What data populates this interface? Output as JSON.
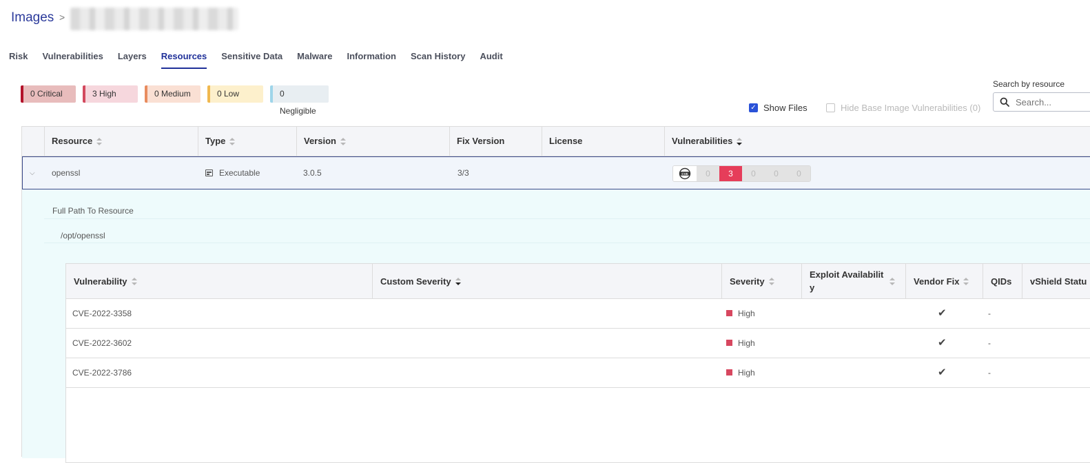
{
  "breadcrumb": {
    "root": "Images",
    "separator": ">"
  },
  "tabs": [
    {
      "label": "Risk",
      "active": false
    },
    {
      "label": "Vulnerabilities",
      "active": false
    },
    {
      "label": "Layers",
      "active": false
    },
    {
      "label": "Resources",
      "active": true
    },
    {
      "label": "Sensitive Data",
      "active": false
    },
    {
      "label": "Malware",
      "active": false
    },
    {
      "label": "Information",
      "active": false
    },
    {
      "label": "Scan History",
      "active": false
    },
    {
      "label": "Audit",
      "active": false
    }
  ],
  "severity_chips": {
    "critical": "0 Critical",
    "high": "3 High",
    "medium": "0 Medium",
    "low": "0 Low",
    "negligible": "0 Negligible"
  },
  "options": {
    "show_files_label": "Show Files",
    "show_files_checked": true,
    "hide_base_label": "Hide Base Image Vulnerabilities (0)",
    "hide_base_checked": false
  },
  "search": {
    "label": "Search by resource",
    "placeholder": "Search..."
  },
  "table": {
    "columns": [
      "Resource",
      "Type",
      "Version",
      "Fix Version",
      "License",
      "Vulnerabilities"
    ],
    "row": {
      "resource": "openssl",
      "type": "Executable",
      "version": "3.0.5",
      "fix_version": "3/3",
      "license": "",
      "vuln_counts": [
        "0",
        "3",
        "0",
        "0",
        "0"
      ]
    }
  },
  "expanded": {
    "path_label": "Full Path To Resource",
    "path_value": "/opt/openssl",
    "columns": {
      "vulnerability": "Vulnerability",
      "custom_severity": "Custom Severity",
      "severity": "Severity",
      "exploit": "Exploit Availabilit y",
      "vendor_fix": "Vendor Fix",
      "qids": "QIDs",
      "vshield": "vShield Statu"
    },
    "rows": [
      {
        "cve": "CVE-2022-3358",
        "severity": "High",
        "vendor_fix": "✔",
        "qids": "-"
      },
      {
        "cve": "CVE-2022-3602",
        "severity": "High",
        "vendor_fix": "✔",
        "qids": "-"
      },
      {
        "cve": "CVE-2022-3786",
        "severity": "High",
        "vendor_fix": "✔",
        "qids": "-"
      }
    ]
  },
  "colors": {
    "accent": "#1f3099",
    "high": "#e63d5a",
    "row_selected_border": "#3b4a8a"
  }
}
